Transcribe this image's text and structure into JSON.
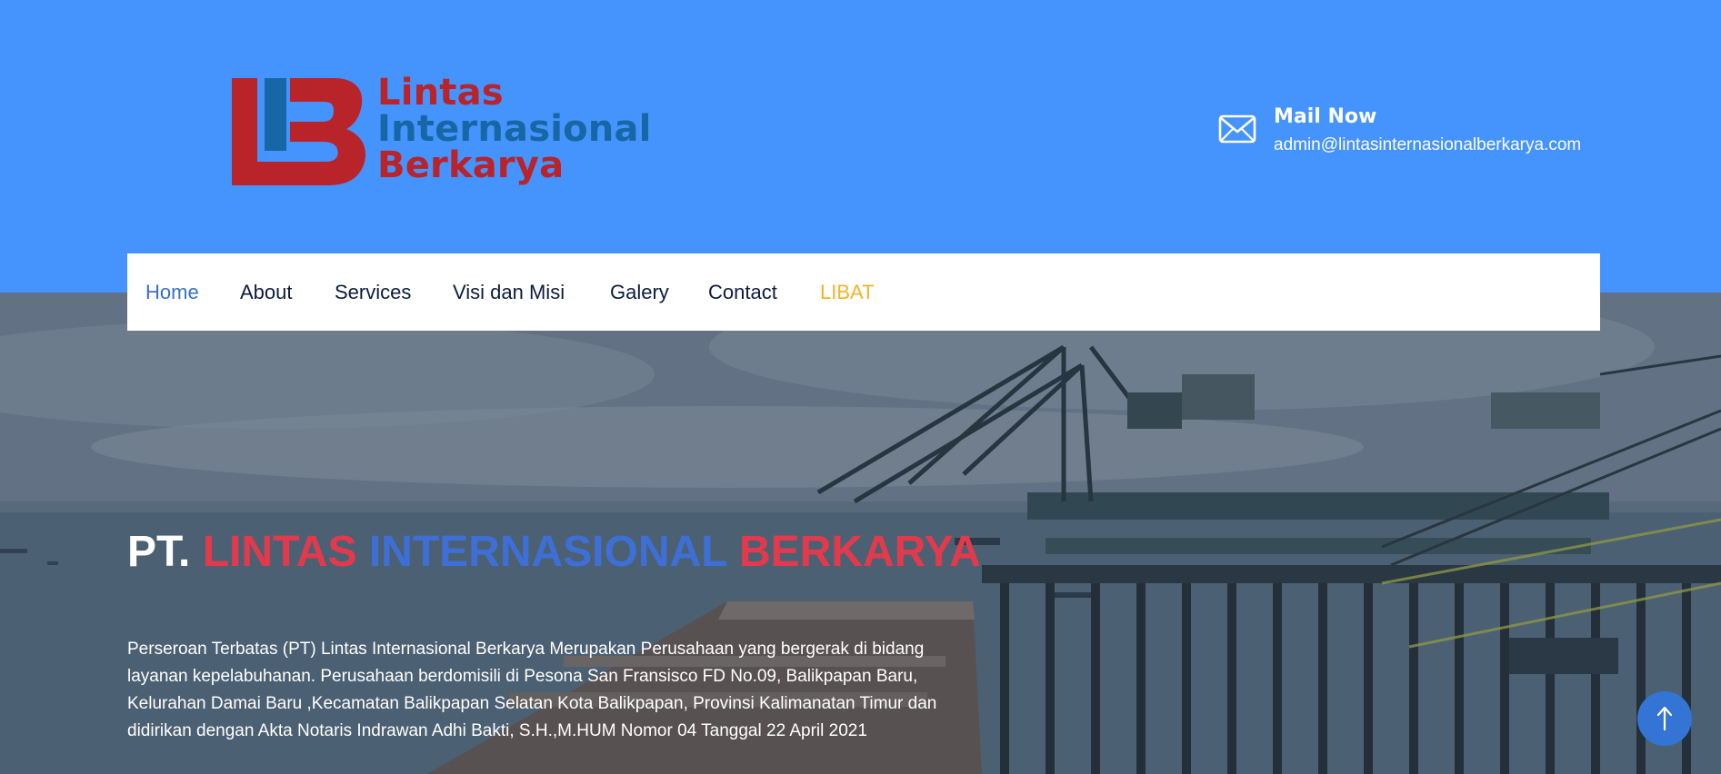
{
  "header": {
    "logo": {
      "line1": "Lintas",
      "line2": "Internasional",
      "line3": "Berkarya"
    },
    "mail": {
      "title": "Mail Now",
      "address": "admin@lintasinternasionalberkarya.com",
      "icon": "envelope-icon"
    }
  },
  "nav": {
    "items": [
      {
        "label": "Home",
        "active": true
      },
      {
        "label": "About"
      },
      {
        "label": "Services"
      },
      {
        "label": "Visi dan Misi"
      },
      {
        "label": "Galery"
      },
      {
        "label": "Contact"
      },
      {
        "label": "LIBAT",
        "highlight": true
      }
    ]
  },
  "hero": {
    "title_prefix": "PT.",
    "title_word1": "LINTAS",
    "title_word2": "INTERNASIONAL",
    "title_word3": "BERKARYA",
    "description": "Perseroan Terbatas (PT) Lintas Internasional Berkarya Merupakan Perusahaan yang bergerak di bidang layanan kepelabuhanan. Perusahaan berdomisili di Pesona San Fransisco FD No.09, Balikpapan Baru, Kelurahan Damai Baru ,Kecamatan Balikpapan Selatan Kota Balikpapan, Provinsi Kalimanatan Timur dan didirikan dengan Akta Notaris Indrawan Adhi Bakti, S.H.,M.HUM Nomor 04 Tanggal 22 April 2021"
  },
  "scroll_top": {
    "icon": "arrow-up-icon"
  },
  "colors": {
    "header_bg": "#4593fd",
    "brand_red": "#b9232a",
    "brand_blue": "#1767a6",
    "nav_active": "#3a6fc4",
    "nav_highlight": "#f3b324",
    "title_red": "#e23a4c",
    "title_blue": "#3d6fd6"
  }
}
